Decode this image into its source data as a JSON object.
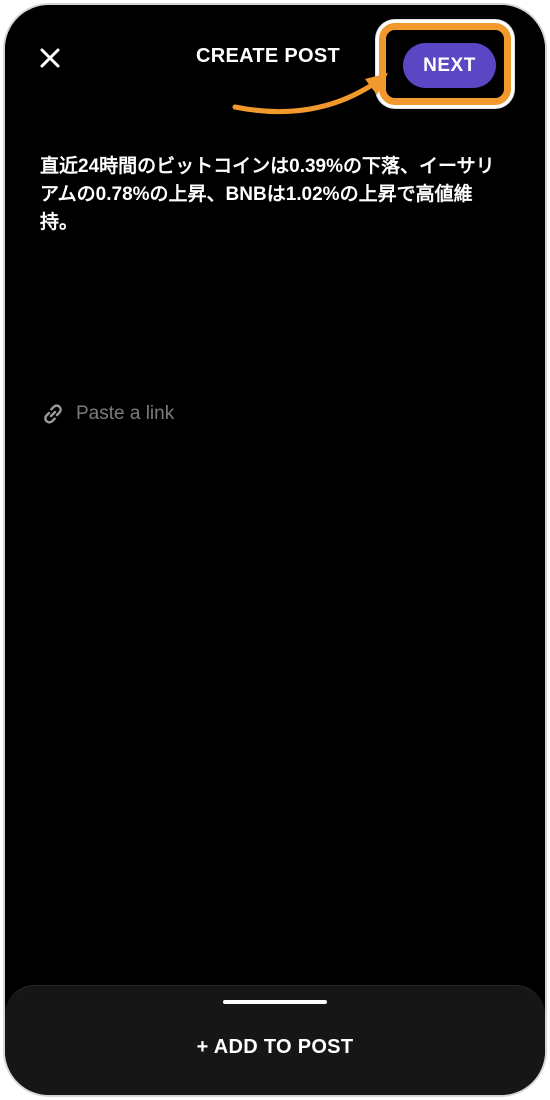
{
  "header": {
    "title": "CREATE POST",
    "next_label": "NEXT",
    "close_icon": "close-icon"
  },
  "post": {
    "text": "直近24時間のビットコインは0.39%の下落、イーサリアムの0.78%の上昇、BNBは1.02%の上昇で高値維持。"
  },
  "link": {
    "icon": "link-icon",
    "placeholder": "Paste a link"
  },
  "bottom_sheet": {
    "add_label": "+ ADD TO POST"
  },
  "colors": {
    "background": "#000000",
    "accent": "#5b47c4",
    "highlight": "#f2992d",
    "placeholder": "#7c7c7c",
    "sheet": "#161616"
  }
}
